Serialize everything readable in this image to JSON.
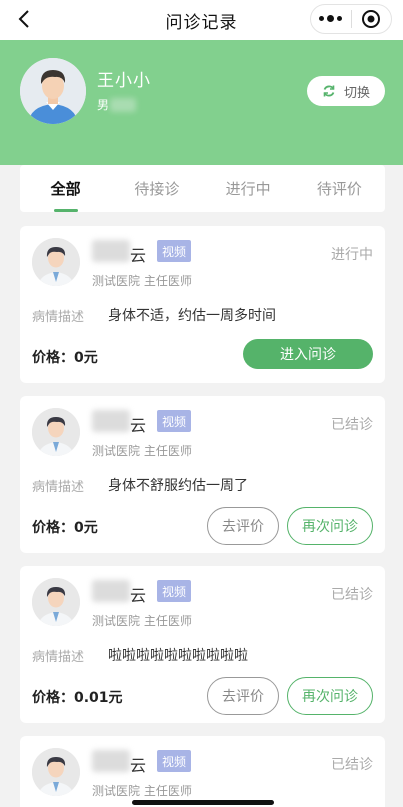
{
  "nav": {
    "title": "问诊记录"
  },
  "user": {
    "name": "王小小",
    "gender": "男",
    "switch_label": "切换"
  },
  "tabs": [
    {
      "label": "全部",
      "active": true
    },
    {
      "label": "待接诊",
      "active": false
    },
    {
      "label": "进行中",
      "active": false
    },
    {
      "label": "待评价",
      "active": false
    }
  ],
  "records": [
    {
      "doctor_name": "云",
      "tag": "视频",
      "hospital_title": "测试医院  主任医师",
      "status": "进行中",
      "desc_label": "病情描述",
      "desc": "身体不适，约估一周多时间",
      "price_label": "价格：",
      "price": "0元",
      "primary_button": "进入问诊"
    },
    {
      "doctor_name": "云",
      "tag": "视频",
      "hospital_title": "测试医院  主任医师",
      "status": "已结诊",
      "desc_label": "病情描述",
      "desc": "身体不舒服约估一周了",
      "price_label": "价格：",
      "price": "0元",
      "review_button": "去评价",
      "again_button": "再次问诊"
    },
    {
      "doctor_name": "云",
      "tag": "视频",
      "hospital_title": "测试医院  主任医师",
      "status": "已结诊",
      "desc_label": "病情描述",
      "desc": "啦啦啦啦啦啦啦啦啦啦",
      "price_label": "价格：",
      "price": "0.01元",
      "review_button": "去评价",
      "again_button": "再次问诊"
    },
    {
      "doctor_name": "云",
      "tag": "视频",
      "hospital_title": "测试医院  主任医师",
      "status": "已结诊"
    }
  ],
  "colors": {
    "header": "#82d08e",
    "accent": "#55b36a",
    "tag": "#a8b4e6"
  }
}
